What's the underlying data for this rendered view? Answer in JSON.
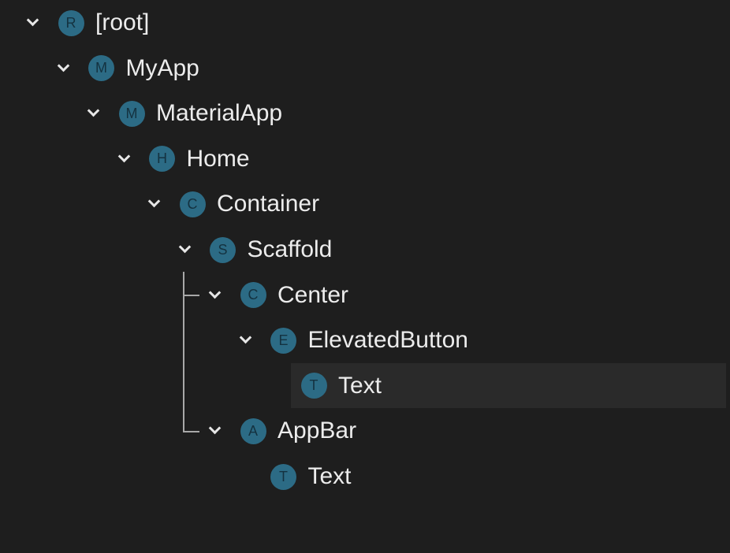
{
  "tree": {
    "nodes": [
      {
        "label": "[root]",
        "badge": "R",
        "level": 0,
        "expanded": true
      },
      {
        "label": "MyApp",
        "badge": "M",
        "level": 1,
        "expanded": true
      },
      {
        "label": "MaterialApp",
        "badge": "M",
        "level": 2,
        "expanded": true
      },
      {
        "label": "Home",
        "badge": "H",
        "level": 3,
        "expanded": true
      },
      {
        "label": "Container",
        "badge": "C",
        "level": 4,
        "expanded": true
      },
      {
        "label": "Scaffold",
        "badge": "S",
        "level": 5,
        "expanded": true
      },
      {
        "label": "Center",
        "badge": "C",
        "level": 6,
        "expanded": true
      },
      {
        "label": "ElevatedButton",
        "badge": "E",
        "level": 7,
        "expanded": true
      },
      {
        "label": "Text",
        "badge": "T",
        "level": 8,
        "expanded": false,
        "leaf": true,
        "selected": true
      },
      {
        "label": "AppBar",
        "badge": "A",
        "level": 6,
        "expanded": true
      },
      {
        "label": "Text",
        "badge": "T",
        "level": 7,
        "expanded": false,
        "leaf": true
      }
    ]
  },
  "colors": {
    "background": "#1e1e1e",
    "badge": "#2c6b85",
    "selected_row": "#2a2a2a"
  }
}
